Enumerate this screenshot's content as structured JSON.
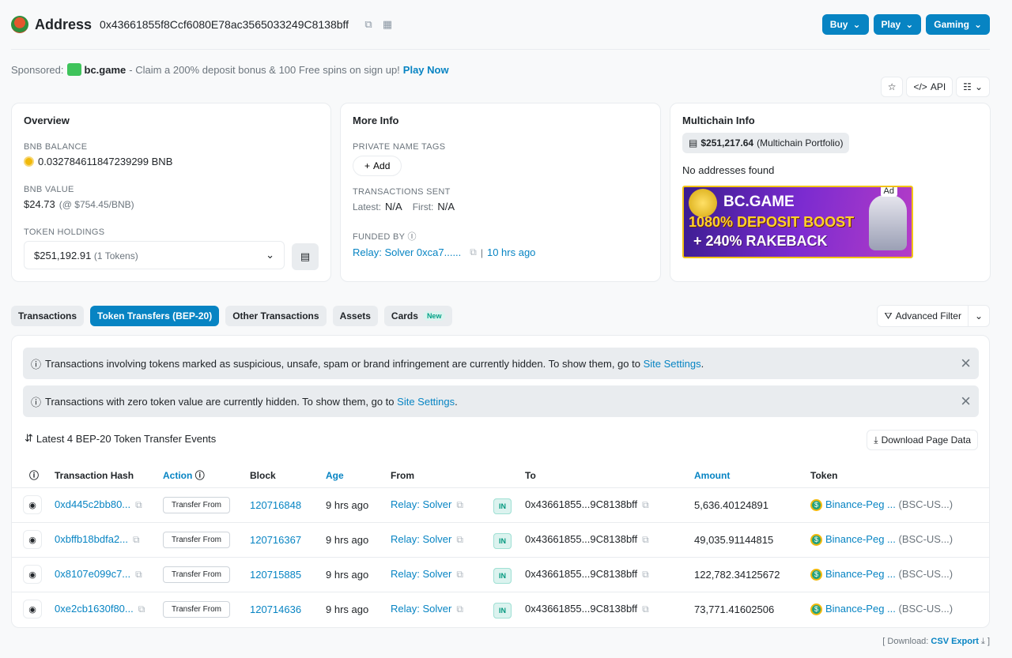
{
  "header": {
    "title": "Address",
    "address": "0x43661855f8Ccf6080E78ac3565033249C8138bff",
    "buttons": [
      "Buy",
      "Play",
      "Gaming"
    ]
  },
  "sponsored": {
    "label": "Sponsored:",
    "brand": "bc.game",
    "text": "- Claim a 200% deposit bonus & 100 Free spins on sign up!",
    "cta": "Play Now"
  },
  "toolbar": {
    "api_label": "API"
  },
  "overview": {
    "title": "Overview",
    "balance_label": "BNB BALANCE",
    "balance_value": "0.032784611847239299 BNB",
    "value_label": "BNB VALUE",
    "value_amount": "$24.73",
    "value_rate": "(@ $754.45/BNB)",
    "holdings_label": "TOKEN HOLDINGS",
    "holdings_amount": "$251,192.91",
    "holdings_count": "(1 Tokens)"
  },
  "more_info": {
    "title": "More Info",
    "tags_label": "PRIVATE NAME TAGS",
    "add_label": "Add",
    "sent_label": "TRANSACTIONS SENT",
    "latest_label": "Latest:",
    "latest_value": "N/A",
    "first_label": "First:",
    "first_value": "N/A",
    "funded_label": "FUNDED BY",
    "funded_by": "Relay: Solver 0xca7......",
    "funded_age": "10 hrs ago"
  },
  "multichain": {
    "title": "Multichain Info",
    "portfolio_value": "$251,217.64",
    "portfolio_label": "(Multichain Portfolio)",
    "no_addresses": "No addresses found",
    "ad_label": "Ad",
    "ad_line1": "BC.GAME",
    "ad_line2": "1080% DEPOSIT BOOST",
    "ad_line3": "+ 240% RAKEBACK"
  },
  "tabs": [
    {
      "label": "Transactions"
    },
    {
      "label": "Token Transfers (BEP-20)"
    },
    {
      "label": "Other Transactions"
    },
    {
      "label": "Assets"
    },
    {
      "label": "Cards"
    }
  ],
  "tab_new_badge": "New",
  "advanced_filter": "Advanced Filter",
  "alerts": {
    "alert1_text": "Transactions involving tokens marked as suspicious, unsafe, spam or brand infringement are currently hidden. To show them, go to",
    "alert1_link": "Site Settings",
    "alert2_text": "Transactions with zero token value are currently hidden. To show them, go to",
    "alert2_link": "Site Settings"
  },
  "latest_events": "Latest 4 BEP-20 Token Transfer Events",
  "download_page_data": "Download Page Data",
  "table": {
    "headers": [
      "Transaction Hash",
      "Action",
      "Block",
      "Age",
      "From",
      "To",
      "Amount",
      "Token"
    ],
    "rows": [
      {
        "hash": "0xd445c2bb80...",
        "action": "Transfer From",
        "block": "120716848",
        "age": "9 hrs ago",
        "from": "Relay: Solver",
        "dir": "IN",
        "to": "0x43661855...9C8138bff",
        "amount": "5,636.40124891",
        "token": "Binance-Peg ...",
        "symbol": "(BSC-US...)"
      },
      {
        "hash": "0xbffb18bdfa2...",
        "action": "Transfer From",
        "block": "120716367",
        "age": "9 hrs ago",
        "from": "Relay: Solver",
        "dir": "IN",
        "to": "0x43661855...9C8138bff",
        "amount": "49,035.91144815",
        "token": "Binance-Peg ...",
        "symbol": "(BSC-US...)"
      },
      {
        "hash": "0x8107e099c7...",
        "action": "Transfer From",
        "block": "120715885",
        "age": "9 hrs ago",
        "from": "Relay: Solver",
        "dir": "IN",
        "to": "0x43661855...9C8138bff",
        "amount": "122,782.34125672",
        "token": "Binance-Peg ...",
        "symbol": "(BSC-US...)"
      },
      {
        "hash": "0xe2cb1630f80...",
        "action": "Transfer From",
        "block": "120714636",
        "age": "9 hrs ago",
        "from": "Relay: Solver",
        "dir": "IN",
        "to": "0x43661855...9C8138bff",
        "amount": "73,771.41602506",
        "token": "Binance-Peg ...",
        "symbol": "(BSC-US...)"
      }
    ]
  },
  "csv": {
    "open": "[ Download:",
    "link": "CSV Export",
    "close": "]"
  }
}
